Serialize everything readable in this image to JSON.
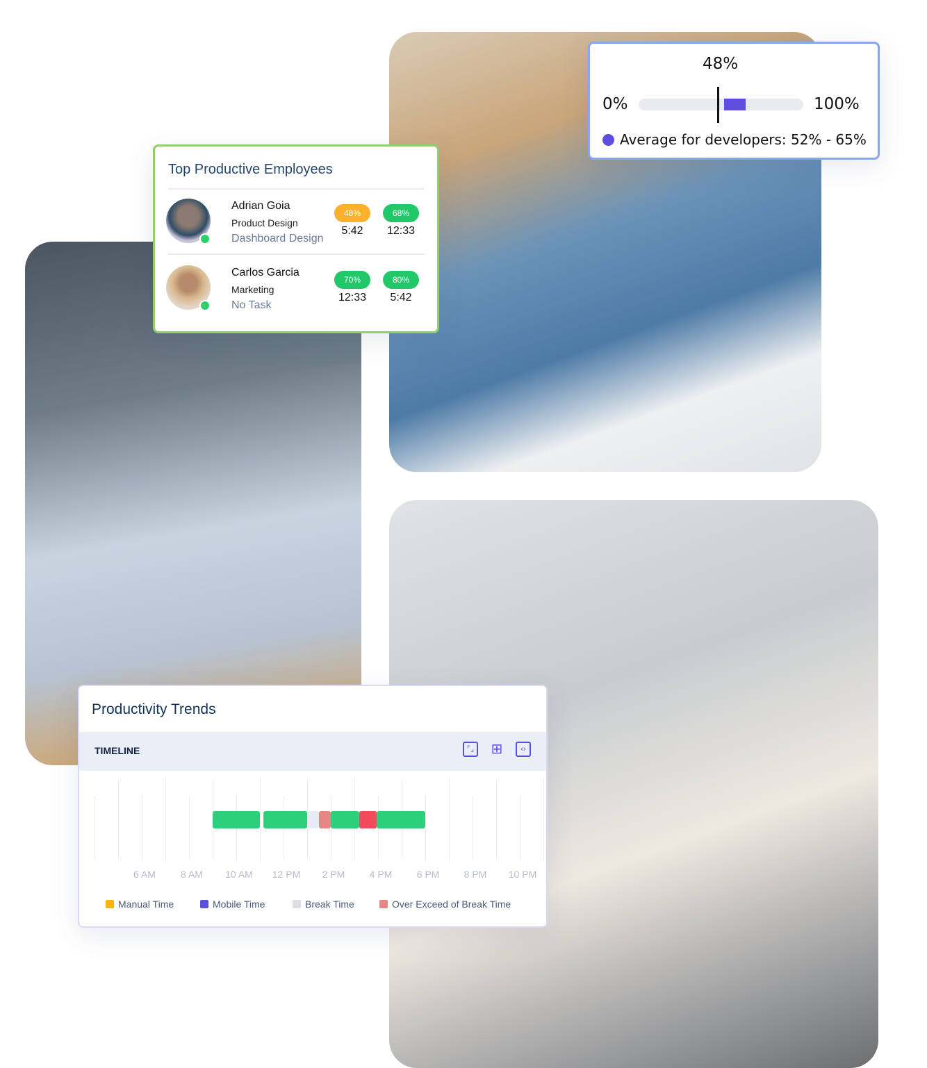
{
  "top_employees": {
    "title": "Top Productive Employees",
    "employees": [
      {
        "name": "Adrian Goia",
        "department": "Product Design",
        "task": "Dashboard Design",
        "status": "online",
        "stats": [
          {
            "badge": "48%",
            "time": "5:42",
            "color": "#fbb12c"
          },
          {
            "badge": "68%",
            "time": "12:33",
            "color": "#22c76a"
          }
        ]
      },
      {
        "name": "Carlos Garcia",
        "department": "Marketing",
        "task": "No Task",
        "status": "online",
        "stats": [
          {
            "badge": "70%",
            "time": "12:33",
            "color": "#22c76a"
          },
          {
            "badge": "80%",
            "time": "5:42",
            "color": "#22c76a"
          }
        ]
      }
    ]
  },
  "gauge": {
    "value_label": "48%",
    "value": 48,
    "min_label": "0%",
    "max_label": "100%",
    "range": [
      52,
      65
    ],
    "range_color": "#5e4ee0",
    "average_text": "Average for developers: 52% - 65%"
  },
  "productivity_trends": {
    "title": "Productivity Trends",
    "section": "TIMELINE",
    "icons": [
      "fullscreen-icon",
      "grid-icon",
      "embed-icon"
    ],
    "chart_data": {
      "type": "timeline",
      "x_ticks": [
        "6 AM",
        "8 AM",
        "10 AM",
        "12 PM",
        "2 PM",
        "4 PM",
        "6 PM",
        "8 PM",
        "10 PM"
      ],
      "x_range_hours": [
        4,
        23
      ],
      "grid": true,
      "segments": [
        {
          "start": 9.0,
          "end": 11.0,
          "kind": "productive",
          "color": "#2ecf7c"
        },
        {
          "start": 11.15,
          "end": 13.0,
          "kind": "productive",
          "color": "#2ecf7c"
        },
        {
          "start": 13.0,
          "end": 13.5,
          "kind": "break",
          "color": "#e6ebf4"
        },
        {
          "start": 13.5,
          "end": 14.0,
          "kind": "over-exceed",
          "color": "#e88585"
        },
        {
          "start": 14.0,
          "end": 15.2,
          "kind": "productive",
          "color": "#2ecf7c"
        },
        {
          "start": 15.2,
          "end": 15.95,
          "kind": "unproductive",
          "color": "#f5495c"
        },
        {
          "start": 15.95,
          "end": 18.0,
          "kind": "productive",
          "color": "#2ecf7c"
        }
      ],
      "legend": [
        {
          "label": "Manual Time",
          "color": "#fbb312"
        },
        {
          "label": "Mobile Time",
          "color": "#5e4ee0"
        },
        {
          "label": "Break Time",
          "color": "#dcdee3"
        },
        {
          "label": "Over Exceed of Break Time",
          "color": "#e88585"
        }
      ]
    }
  }
}
